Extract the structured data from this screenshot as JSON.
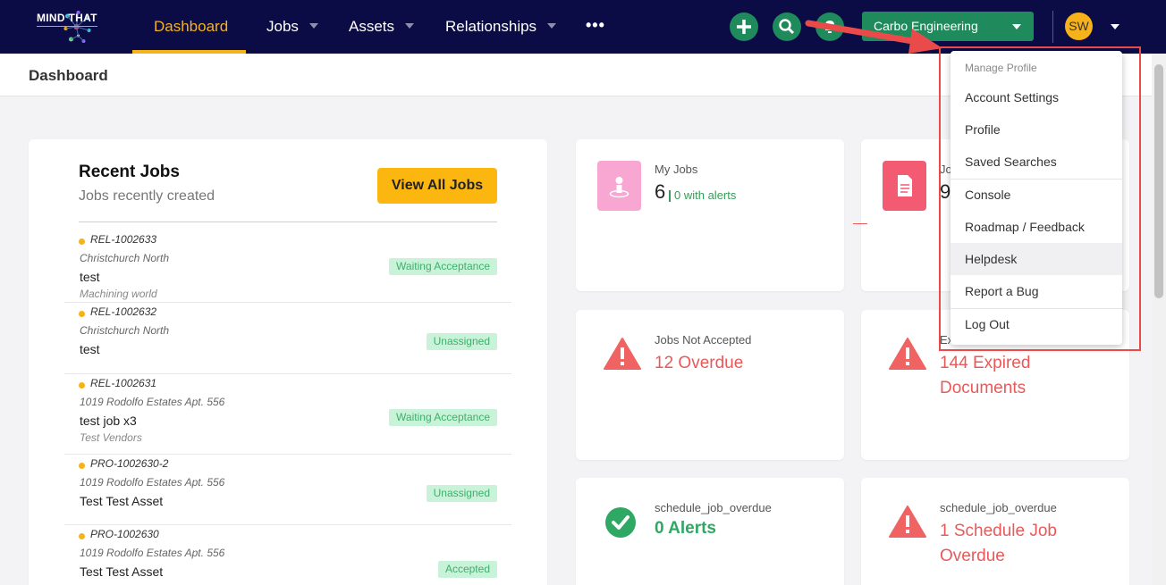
{
  "nav": {
    "brand": "MIND THAT",
    "items": [
      {
        "label": "Dashboard",
        "active": true
      },
      {
        "label": "Jobs"
      },
      {
        "label": "Assets"
      },
      {
        "label": "Relationships"
      }
    ],
    "more": "•••",
    "org": "Carbo Engineering",
    "avatar_initials": "SW",
    "accent_color": "#f6b21a",
    "green_color": "#1f8a5b"
  },
  "page": {
    "title": "Dashboard"
  },
  "recent_jobs": {
    "title": "Recent Jobs",
    "subtitle": "Jobs recently created",
    "view_all": "View All Jobs",
    "jobs": [
      {
        "code": "REL-1002633",
        "location": "Christchurch North",
        "name": "test",
        "vendor": "Machining world",
        "status": "Waiting Acceptance"
      },
      {
        "code": "REL-1002632",
        "location": "Christchurch North",
        "name": "test",
        "vendor": "",
        "status": "Unassigned"
      },
      {
        "code": "REL-1002631",
        "location": "1019 Rodolfo Estates Apt. 556",
        "name": "test job x3",
        "vendor": "Test Vendors",
        "status": "Waiting Acceptance"
      },
      {
        "code": "PRO-1002630-2",
        "location": "1019 Rodolfo Estates Apt. 556",
        "name": "Test Test Asset",
        "vendor": "",
        "status": "Unassigned"
      },
      {
        "code": "PRO-1002630",
        "location": "1019 Rodolfo Estates Apt. 556",
        "name": "Test Test Asset",
        "vendor": "",
        "status": "Accepted"
      }
    ]
  },
  "stats": {
    "my_jobs": {
      "label": "My Jobs",
      "value": "6",
      "alerts": "0 with alerts"
    },
    "second": {
      "label": "Jo",
      "value": "9"
    },
    "not_accepted": {
      "label": "Jobs Not Accepted",
      "value": "12 Overdue"
    },
    "expired": {
      "label": "Ex",
      "value": "144 Expired Documents"
    },
    "schedule_left": {
      "label": "schedule_job_overdue",
      "value": "0 Alerts"
    },
    "schedule_right": {
      "label": "schedule_job_overdue",
      "value": "1 Schedule Job Overdue"
    }
  },
  "profile_menu": {
    "header": "Manage Profile",
    "items": [
      "Account Settings",
      "Profile",
      "Saved Searches",
      "Console",
      "Roadmap / Feedback",
      "Helpdesk",
      "Report a Bug",
      "Log Out"
    ],
    "hovered": "Helpdesk"
  }
}
